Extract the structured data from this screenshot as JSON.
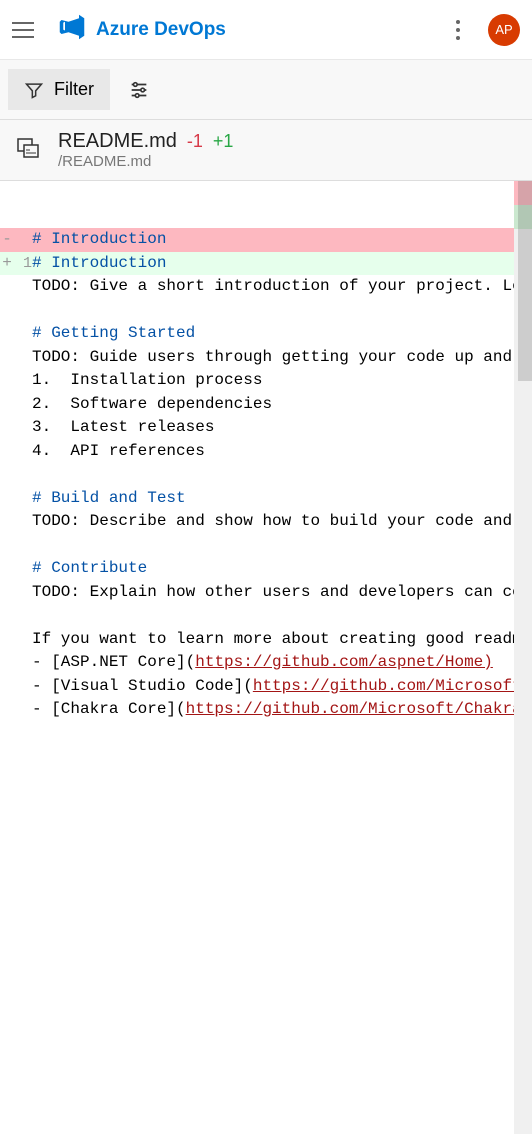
{
  "header": {
    "app_title": "Azure DevOps",
    "avatar_initials": "AP"
  },
  "toolbar": {
    "filter_label": "Filter"
  },
  "file": {
    "name": "README.md",
    "diff_minus": "-1",
    "diff_plus": "+1",
    "path": "/README.md"
  },
  "code": {
    "lines": [
      {
        "num": "",
        "marker": "-",
        "type": "del",
        "text": "# Introduction",
        "heading": true
      },
      {
        "num": "1",
        "marker": "+",
        "type": "add",
        "text": "# Introduction ",
        "heading": true
      },
      {
        "num": "",
        "marker": "",
        "type": "",
        "text": "TODO: Give a short introduction of your project. Let this section explain the objectives"
      },
      {
        "num": "",
        "marker": "",
        "type": "",
        "text": ""
      },
      {
        "num": "",
        "marker": "",
        "type": "",
        "text": "# Getting Started",
        "heading": true
      },
      {
        "num": "",
        "marker": "",
        "type": "",
        "text": "TODO: Guide users through getting your code up and running on their own system."
      },
      {
        "num": "",
        "marker": "",
        "type": "",
        "text": "1.  Installation process"
      },
      {
        "num": "",
        "marker": "",
        "type": "",
        "text": "2.  Software dependencies"
      },
      {
        "num": "",
        "marker": "",
        "type": "",
        "text": "3.  Latest releases"
      },
      {
        "num": "",
        "marker": "",
        "type": "",
        "text": "4.  API references"
      },
      {
        "num": "",
        "marker": "",
        "type": "",
        "text": ""
      },
      {
        "num": "",
        "marker": "",
        "type": "",
        "text": "# Build and Test",
        "heading": true
      },
      {
        "num": "",
        "marker": "",
        "type": "",
        "text": "TODO: Describe and show how to build your code and run the tests."
      },
      {
        "num": "",
        "marker": "",
        "type": "",
        "text": ""
      },
      {
        "num": "",
        "marker": "",
        "type": "",
        "text": "# Contribute",
        "heading": true
      },
      {
        "num": "",
        "marker": "",
        "type": "",
        "text": "TODO: Explain how other users and developers can contribute to make your code better."
      },
      {
        "num": "",
        "marker": "",
        "type": "",
        "text": ""
      },
      {
        "num": "",
        "marker": "",
        "type": "",
        "text": "If you want to learn more about creating good readme files then refer the following"
      },
      {
        "num": "",
        "marker": "",
        "type": "",
        "link_prefix": "- [ASP.NET Core](",
        "link_url": "https://github.com/aspnet/Home)"
      },
      {
        "num": "",
        "marker": "",
        "type": "",
        "link_prefix": "- [Visual Studio Code](",
        "link_url": "https://github.com/Microsoft/vscode)"
      },
      {
        "num": "",
        "marker": "",
        "type": "",
        "link_prefix": "- [Chakra Core](",
        "link_url": "https://github.com/Microsoft/ChakraCore)"
      }
    ]
  }
}
